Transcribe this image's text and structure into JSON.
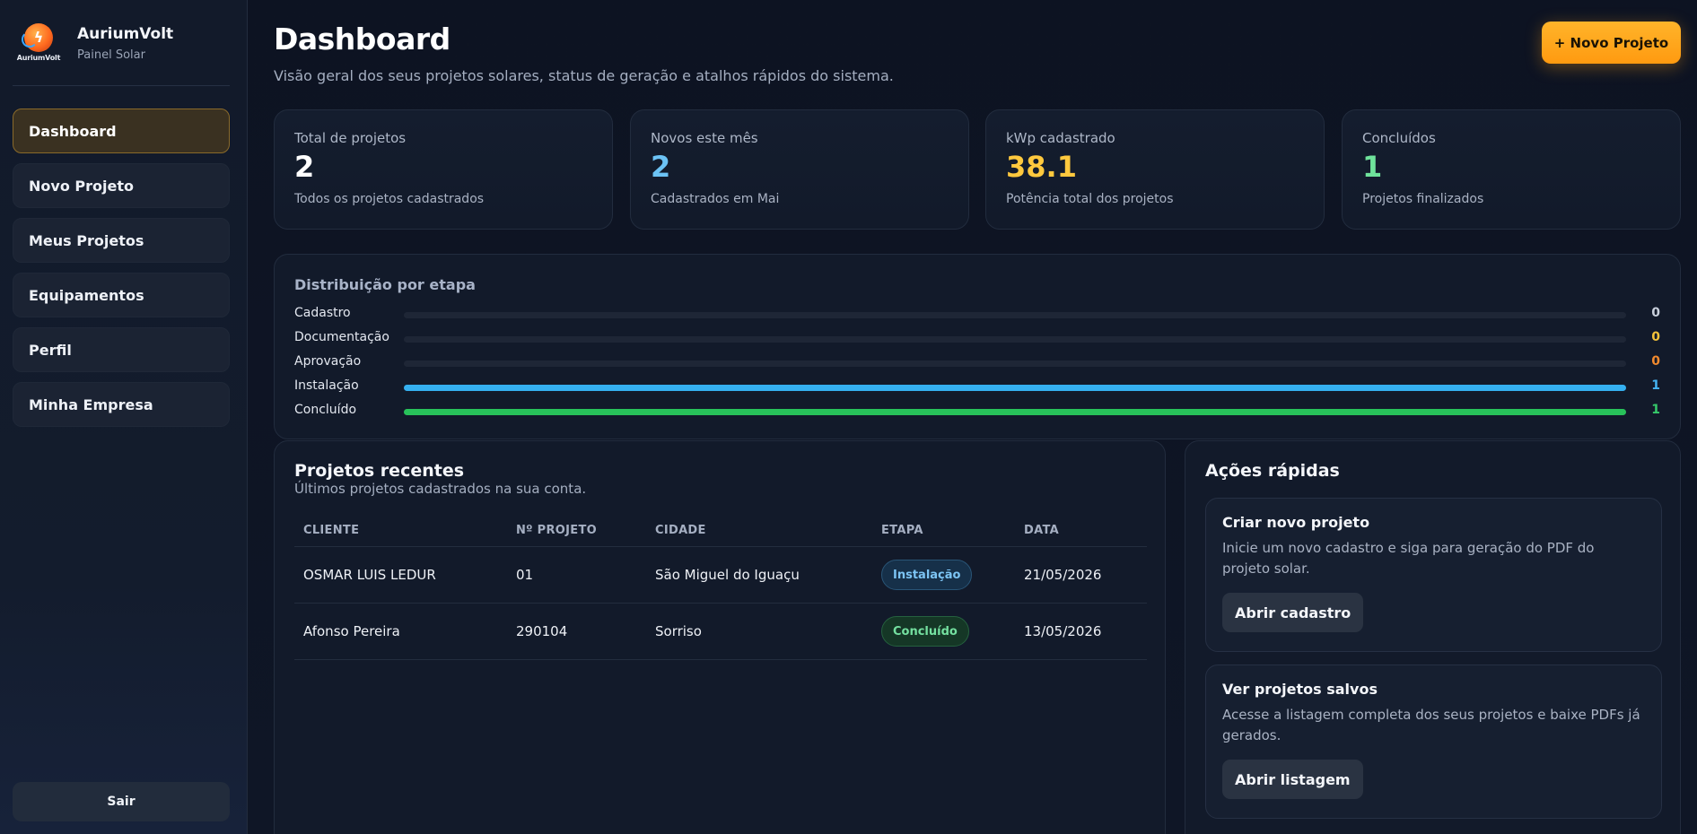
{
  "sidebar": {
    "brand_name": "AuriumVolt",
    "brand_sub": "Painel Solar",
    "logo_text": "AuriumVolt",
    "items": [
      {
        "label": "Dashboard"
      },
      {
        "label": "Novo Projeto"
      },
      {
        "label": "Meus Projetos"
      },
      {
        "label": "Equipamentos"
      },
      {
        "label": "Perfil"
      },
      {
        "label": "Minha Empresa"
      }
    ],
    "logout_label": "Sair"
  },
  "header": {
    "title": "Dashboard",
    "subtitle": "Visão geral dos seus projetos solares, status de geração e atalhos rápidos do sistema.",
    "new_project_label": "+ Novo Projeto"
  },
  "stats": [
    {
      "label": "Total de projetos",
      "value": "2",
      "desc": "Todos os projetos cadastrados",
      "color": "#ffffff"
    },
    {
      "label": "Novos este mês",
      "value": "2",
      "desc": "Cadastrados em Mai",
      "color": "#6cc3f5"
    },
    {
      "label": "kWp cadastrado",
      "value": "38.1",
      "desc": "Potência total dos projetos",
      "color": "#ffc93e"
    },
    {
      "label": "Concluídos",
      "value": "1",
      "desc": "Projetos finalizados",
      "color": "#6fe39b"
    }
  ],
  "distribution": {
    "title": "Distribuição por etapa",
    "rows": [
      {
        "label": "Cadastro",
        "count": "0",
        "fraction": 0,
        "bar_color": "#1e2636",
        "count_color": "#c9d0dc"
      },
      {
        "label": "Documentação",
        "count": "0",
        "fraction": 0,
        "bar_color": "#1e2636",
        "count_color": "#f5c33a"
      },
      {
        "label": "Aprovação",
        "count": "0",
        "fraction": 0,
        "bar_color": "#1e2636",
        "count_color": "#f28a2e"
      },
      {
        "label": "Instalação",
        "count": "1",
        "fraction": 1,
        "bar_color": "#35b0f0",
        "count_color": "#45b4f2"
      },
      {
        "label": "Concluído",
        "count": "1",
        "fraction": 1,
        "bar_color": "#28c25a",
        "count_color": "#36c96a"
      }
    ]
  },
  "recent": {
    "title": "Projetos recentes",
    "subtitle": "Últimos projetos cadastrados na sua conta.",
    "headers": [
      "CLIENTE",
      "Nº PROJETO",
      "CIDADE",
      "ETAPA",
      "DATA"
    ],
    "rows": [
      {
        "cliente": "OSMAR LUIS LEDUR",
        "numero": "01",
        "cidade": "São Miguel do Iguaçu",
        "etapa": "Instalação",
        "etapa_kind": "inst",
        "data": "21/05/2026"
      },
      {
        "cliente": "Afonso Pereira",
        "numero": "290104",
        "cidade": "Sorriso",
        "etapa": "Concluído",
        "etapa_kind": "conc",
        "data": "13/05/2026"
      }
    ]
  },
  "quick": {
    "title": "Ações rápidas",
    "cards": [
      {
        "title": "Criar novo projeto",
        "desc": "Inicie um novo cadastro e siga para geração do PDF do projeto solar.",
        "button": "Abrir cadastro"
      },
      {
        "title": "Ver projetos salvos",
        "desc": "Acesse a listagem completa dos seus projetos e baixe PDFs já gerados.",
        "button": "Abrir listagem"
      }
    ]
  }
}
